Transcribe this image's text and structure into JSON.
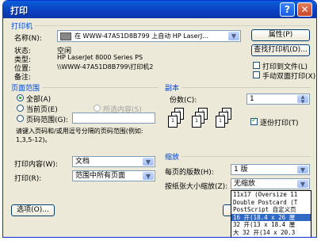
{
  "window": {
    "title": "打印",
    "help_glyph": "?",
    "close_glyph": "✕"
  },
  "printer": {
    "group_title": "打印机",
    "name_label": "名称(N):",
    "name_value": "在 WWW-47A51D8B799 上自动 HP LaserJ...",
    "properties_button": "属性(P)",
    "status_label": "状态:",
    "status_value": "空闲",
    "type_label": "类型:",
    "type_value": "HP LaserJet 8000 Series PS",
    "where_label": "位置:",
    "where_value": "\\\\WWW-47A51D8B799\\打印机2",
    "comment_label": "备注:",
    "find_button": "查找打印机(D)...",
    "print_to_file_label": "打印到文件(L)",
    "manual_duplex_label": "手动双面打印(X)"
  },
  "page_range": {
    "group_title": "页面范围",
    "all_label": "全部(A)",
    "current_label": "当前页(E)",
    "selection_label": "所选内容(S)",
    "pages_label": "页码范围(G):",
    "pages_value": "",
    "hint": "请键入页码和/或用逗号分隔的页码范围(例如: 1,3,5-12)。",
    "selected": "all"
  },
  "copies": {
    "group_title": "副本",
    "number_label": "份数(C):",
    "number_value": "1",
    "collate_label": "逐份打印(T)",
    "collate_checked": true
  },
  "print_what": {
    "label": "打印内容(W):",
    "value": "文档"
  },
  "print_range": {
    "label": "打印(R):",
    "value": "范围中所有页面"
  },
  "zoom": {
    "group_title": "缩放",
    "pages_per_sheet_label": "每页的版数(H):",
    "pages_per_sheet_value": "1 版",
    "scale_label": "按纸张大小缩放(Z):",
    "scale_value": "无缩放",
    "options": [
      "11x17 (Oversize 11",
      "Double Postcard (T",
      "PostScript 自定义页",
      "16 开(18.4 x 26 厘",
      "32 开(13 x 18.4 厘",
      "大 32 开(14 x 20.3"
    ],
    "selected_index": 3
  },
  "options_button": "选项(O)..."
}
